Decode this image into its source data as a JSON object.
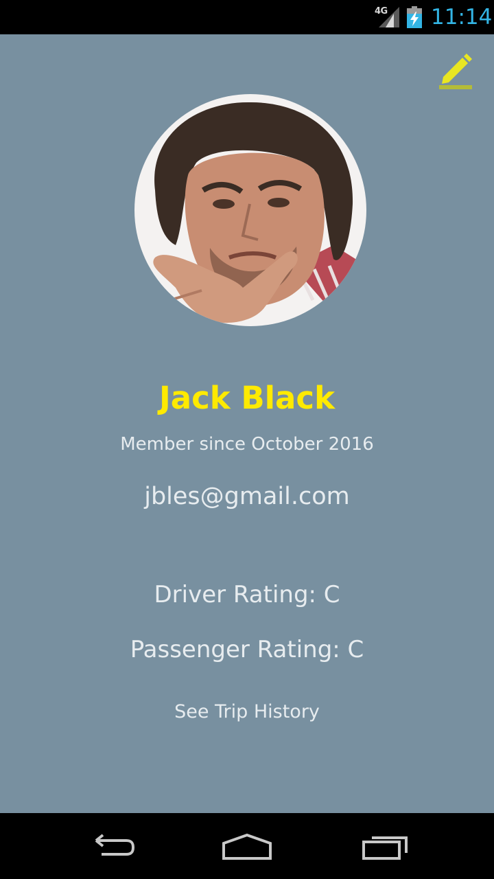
{
  "status_bar": {
    "network_type": "4G",
    "time": "11:14",
    "icons": [
      "signal-icon",
      "battery-charging-icon"
    ]
  },
  "toolbar": {
    "edit_icon": "pencil-edit-icon",
    "accent_color": "#d8dc2a"
  },
  "profile": {
    "name": "Jack Black",
    "member_since": "Member since October 2016",
    "email": "jbles@gmail.com",
    "driver_rating": "Driver Rating: C",
    "passenger_rating": "Passenger Rating: C",
    "trip_history_link": "See Trip History"
  },
  "theme": {
    "background": "#7890a0",
    "name_color": "#ffea00",
    "text_color": "#e7ecef"
  },
  "nav_bar": {
    "icons": [
      "back-icon",
      "home-icon",
      "recents-icon"
    ]
  }
}
